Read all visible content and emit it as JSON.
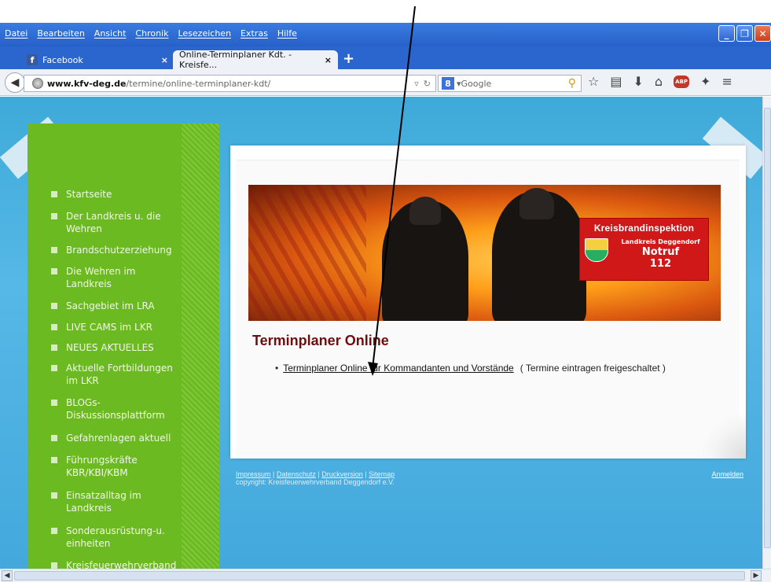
{
  "menu": [
    "Datei",
    "Bearbeiten",
    "Ansicht",
    "Chronik",
    "Lesezeichen",
    "Extras",
    "Hilfe"
  ],
  "tabs": [
    {
      "label": "Facebook",
      "close": "×"
    },
    {
      "label": "Online-Terminplaner Kdt. - Kreisfe...",
      "close": "×"
    }
  ],
  "newtab": "+",
  "url": {
    "host": "www.kfv-deg.de",
    "path": "/termine/online-terminplaner-kdt/"
  },
  "search": {
    "engine_icon": "8",
    "placeholder": "Google"
  },
  "toolbar_icons": [
    "star-icon",
    "reading-list-icon",
    "download-icon",
    "home-icon",
    "adblock-icon",
    "extension-icon",
    "menu-icon"
  ],
  "sidebar": {
    "items": [
      {
        "label": "Startseite"
      },
      {
        "label": "Der Landkreis u. die Wehren"
      },
      {
        "label": "Brandschutzerziehung"
      },
      {
        "label": "Die Wehren im Landkreis"
      },
      {
        "label": "Sachgebiet im LRA"
      },
      {
        "label": "LIVE CAMS im LKR"
      },
      {
        "label": "NEUES AKTUELLES"
      },
      {
        "label": "Aktuelle Fortbildungen im LKR"
      },
      {
        "label": "BLOGs-Diskussionsplattform"
      },
      {
        "label": "Gefahrenlagen aktuell"
      },
      {
        "label": "Führungskräfte KBR/KBI/KBM"
      },
      {
        "label": "Einsatzalltag im Landkreis"
      },
      {
        "label": "Sonderausrüstung-u. einheiten"
      },
      {
        "label": "Kreisfeuerwehrverband"
      }
    ]
  },
  "banner": {
    "title": "Kreisbrandinspektion",
    "subtitle": "Landkreis Deggendorf",
    "notruf": "Notruf",
    "number": "112"
  },
  "content": {
    "heading": "Terminplaner Online",
    "link": "Terminplaner Online für Kommandanten und Vorstände",
    "note": "( Termine eintragen freigeschaltet )"
  },
  "footer": {
    "links": [
      "Impressum",
      "Datenschutz",
      "Druckversion",
      "Sitemap"
    ],
    "copyright": "copyright: Kreisfeuerwehrverband Deggendorf e.V.",
    "login": "Anmelden"
  }
}
